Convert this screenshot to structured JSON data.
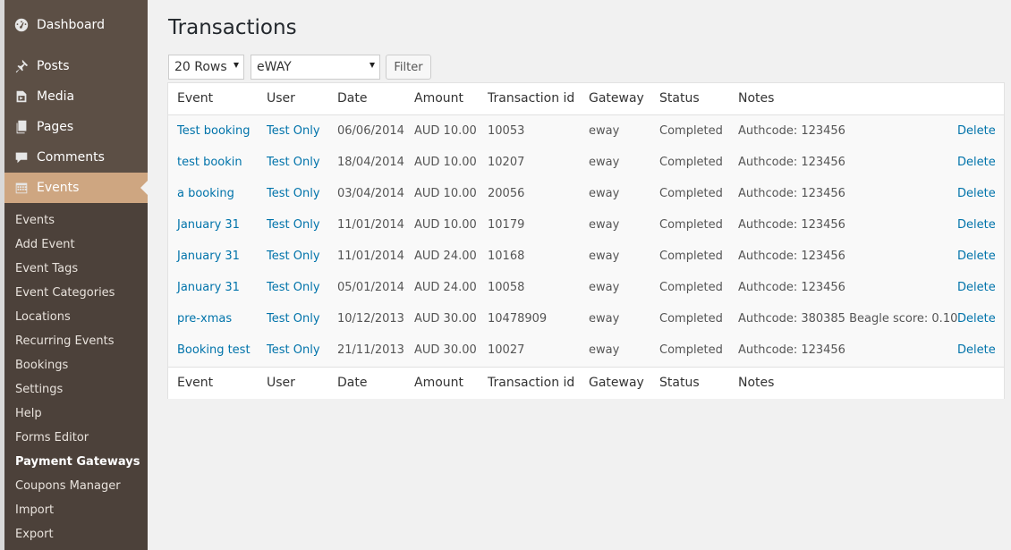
{
  "sidebar": {
    "menu": [
      {
        "label": "Dashboard",
        "icon": "dashboard-icon"
      },
      {
        "label": "Posts",
        "icon": "pushpin-icon"
      },
      {
        "label": "Media",
        "icon": "media-icon"
      },
      {
        "label": "Pages",
        "icon": "pages-icon"
      },
      {
        "label": "Comments",
        "icon": "comment-icon"
      },
      {
        "label": "Events",
        "icon": "calendar-icon",
        "active": true
      }
    ],
    "submenu": [
      "Events",
      "Add Event",
      "Event Tags",
      "Event Categories",
      "Locations",
      "Recurring Events",
      "Bookings",
      "Settings",
      "Help",
      "Forms Editor",
      "Payment Gateways",
      "Coupons Manager",
      "Import",
      "Export"
    ],
    "current_submenu": "Payment Gateways"
  },
  "page": {
    "title": "Transactions"
  },
  "controls": {
    "rows_select": "20 Rows",
    "gateway_select": "eWAY",
    "filter_label": "Filter"
  },
  "table": {
    "columns": [
      "Event",
      "User",
      "Date",
      "Amount",
      "Transaction id",
      "Gateway",
      "Status",
      "Notes"
    ],
    "rows": [
      {
        "event": "Test booking",
        "user": "Test Only",
        "date": "06/06/2014",
        "amount": "AUD 10.00",
        "txn": "10053",
        "gateway": "eway",
        "status": "Completed",
        "notes": "Authcode: 123456",
        "action": "Delete"
      },
      {
        "event": "test bookin",
        "user": "Test Only",
        "date": "18/04/2014",
        "amount": "AUD 10.00",
        "txn": "10207",
        "gateway": "eway",
        "status": "Completed",
        "notes": "Authcode: 123456",
        "action": "Delete"
      },
      {
        "event": "a booking",
        "user": "Test Only",
        "date": "03/04/2014",
        "amount": "AUD 10.00",
        "txn": "20056",
        "gateway": "eway",
        "status": "Completed",
        "notes": "Authcode: 123456",
        "action": "Delete"
      },
      {
        "event": "January 31",
        "user": "Test Only",
        "date": "11/01/2014",
        "amount": "AUD 10.00",
        "txn": "10179",
        "gateway": "eway",
        "status": "Completed",
        "notes": "Authcode: 123456",
        "action": "Delete"
      },
      {
        "event": "January 31",
        "user": "Test Only",
        "date": "11/01/2014",
        "amount": "AUD 24.00",
        "txn": "10168",
        "gateway": "eway",
        "status": "Completed",
        "notes": "Authcode: 123456",
        "action": "Delete"
      },
      {
        "event": "January 31",
        "user": "Test Only",
        "date": "05/01/2014",
        "amount": "AUD 24.00",
        "txn": "10058",
        "gateway": "eway",
        "status": "Completed",
        "notes": "Authcode: 123456",
        "action": "Delete"
      },
      {
        "event": "pre-xmas",
        "user": "Test Only",
        "date": "10/12/2013",
        "amount": "AUD 30.00",
        "txn": "10478909",
        "gateway": "eway",
        "status": "Completed",
        "notes": "Authcode: 380385 Beagle score: 0.10",
        "action": "Delete"
      },
      {
        "event": "Booking test",
        "user": "Test Only",
        "date": "21/11/2013",
        "amount": "AUD 30.00",
        "txn": "10027",
        "gateway": "eway",
        "status": "Completed",
        "notes": "Authcode: 123456",
        "action": "Delete"
      }
    ]
  }
}
